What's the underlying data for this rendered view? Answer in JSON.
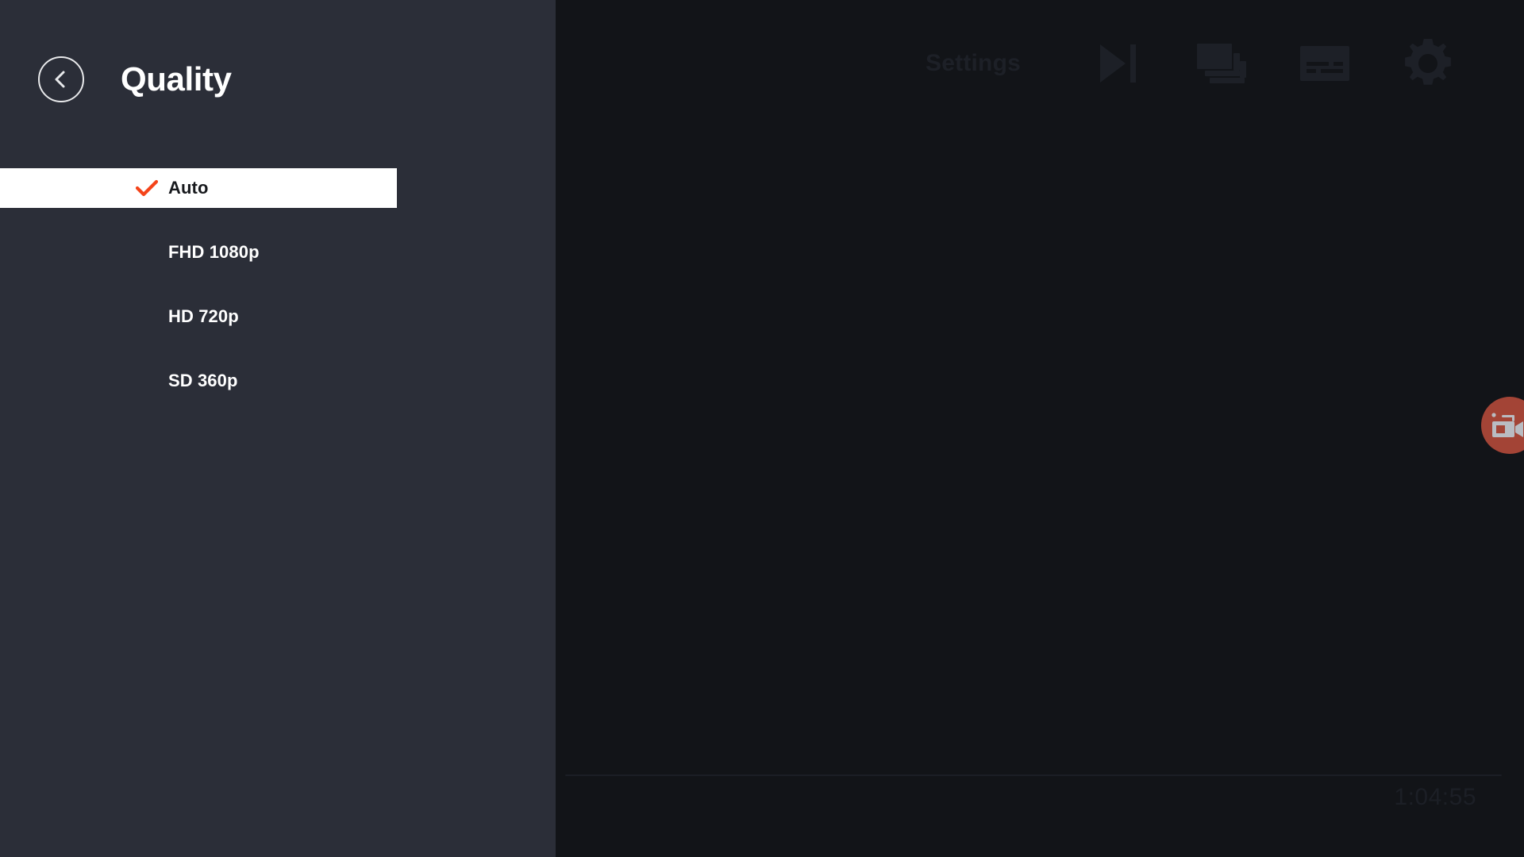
{
  "colors": {
    "panel_bg": "#2b2e38",
    "player_bg": "#121418",
    "selected_row_bg": "#ffffff",
    "accent_check": "#f4441a",
    "record_fab_bg": "#a34436",
    "muted_icon": "#1d2027",
    "text_primary": "#ffffff",
    "text_on_selected": "#17191d"
  },
  "panel": {
    "back_button": {
      "name": "back",
      "icon": "chevron-left-icon"
    },
    "title": "Quality",
    "options": [
      {
        "label": "Auto",
        "selected": true,
        "icon": "check-icon"
      },
      {
        "label": "FHD 1080p",
        "selected": false,
        "icon": ""
      },
      {
        "label": "HD 720p",
        "selected": false,
        "icon": ""
      },
      {
        "label": "SD 360p",
        "selected": false,
        "icon": ""
      }
    ]
  },
  "player": {
    "topbar": {
      "label": "Settings",
      "icons": [
        {
          "name": "play-next-icon",
          "title": "Play next"
        },
        {
          "name": "playlist-icon",
          "title": "Playlist"
        },
        {
          "name": "subtitles-icon",
          "title": "Subtitles"
        },
        {
          "name": "gear-icon",
          "title": "Settings"
        }
      ]
    },
    "progress": {
      "percent": 0
    },
    "time": "1:04:55",
    "record_button": {
      "name": "record-camera-icon",
      "title": "Record"
    }
  }
}
